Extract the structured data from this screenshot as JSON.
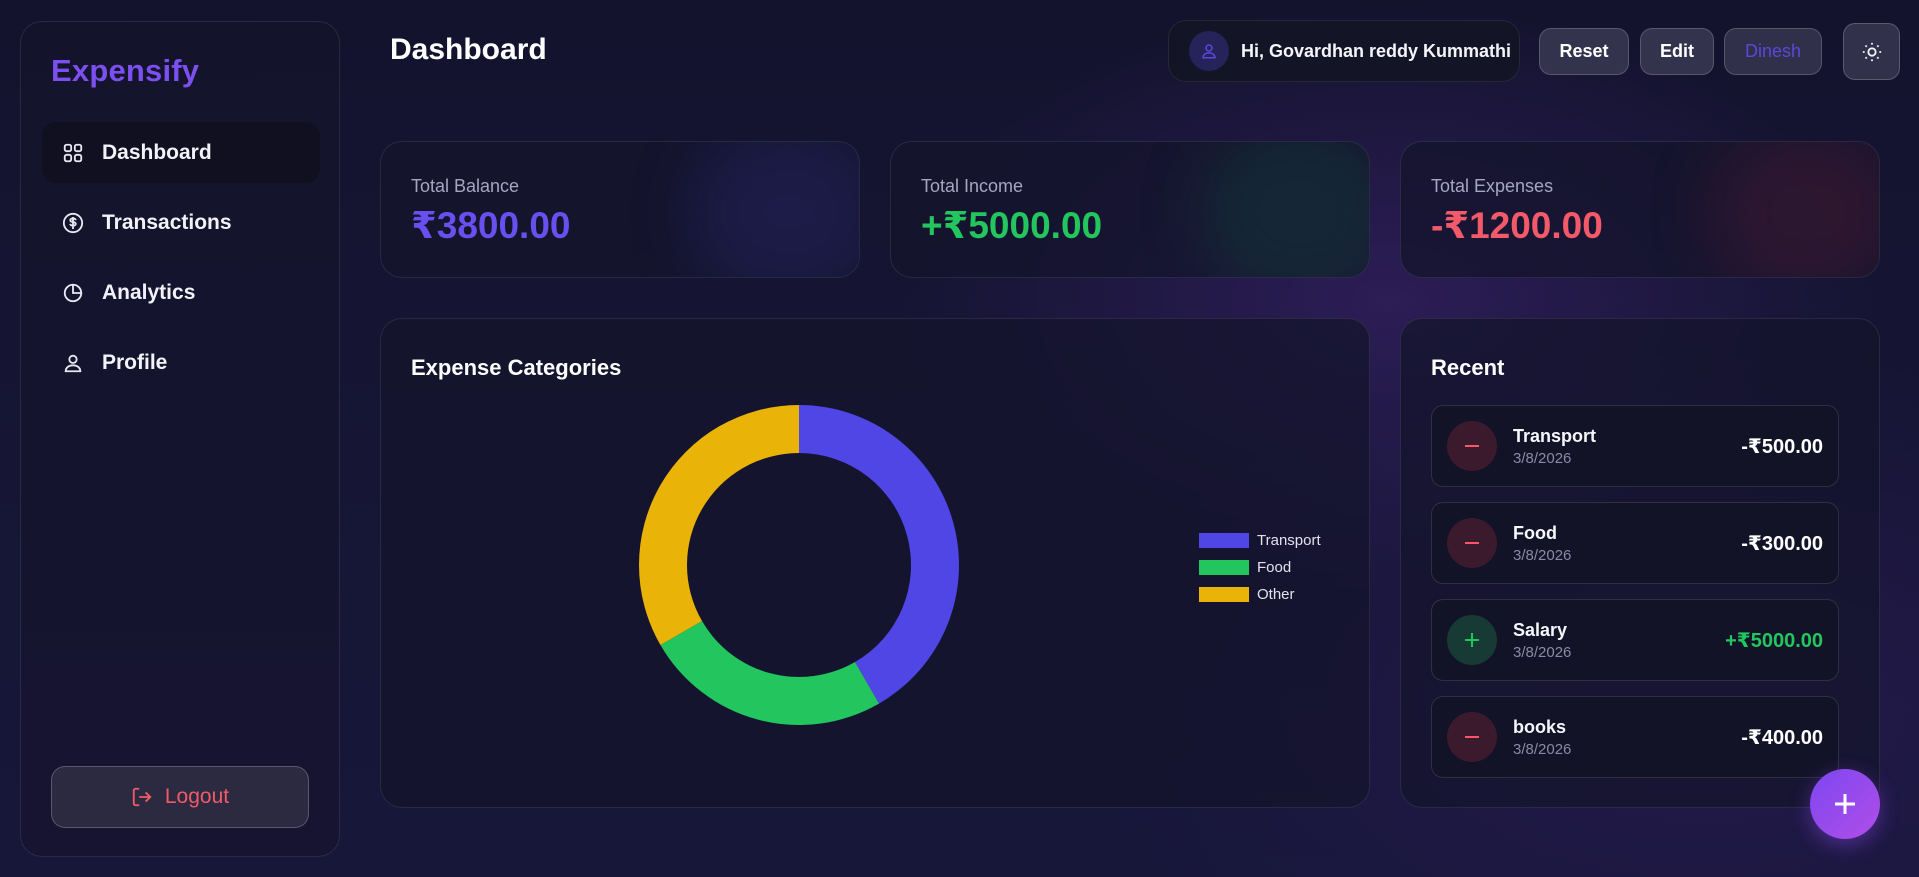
{
  "brand": "Expensify",
  "nav": [
    {
      "label": "Dashboard",
      "icon": "grid-icon",
      "active": true
    },
    {
      "label": "Transactions",
      "icon": "dollar-circle-icon",
      "active": false
    },
    {
      "label": "Analytics",
      "icon": "pie-chart-icon",
      "active": false
    },
    {
      "label": "Profile",
      "icon": "user-icon",
      "active": false
    }
  ],
  "logout_label": "Logout",
  "header": {
    "title": "Dashboard",
    "greeting": "Hi, Govardhan reddy Kummathi",
    "reset_label": "Reset",
    "edit_label": "Edit",
    "user_label": "Dinesh"
  },
  "stats": {
    "balance": {
      "label": "Total Balance",
      "value": "₹3800.00"
    },
    "income": {
      "label": "Total Income",
      "value": "+₹5000.00"
    },
    "expenses": {
      "label": "Total Expenses",
      "value": "-₹1200.00"
    }
  },
  "chart_title": "Expense Categories",
  "chart_data": {
    "type": "pie",
    "categories": [
      "Transport",
      "Food",
      "Other"
    ],
    "values": [
      500,
      300,
      400
    ],
    "colors": [
      "#4f46e5",
      "#22c55e",
      "#eab308"
    ],
    "legend": "right"
  },
  "recent": {
    "title": "Recent",
    "items": [
      {
        "name": "Transport",
        "date": "3/8/2026",
        "amount": "-₹500.00",
        "type": "expense"
      },
      {
        "name": "Food",
        "date": "3/8/2026",
        "amount": "-₹300.00",
        "type": "expense"
      },
      {
        "name": "Salary",
        "date": "3/8/2026",
        "amount": "+₹5000.00",
        "type": "income"
      },
      {
        "name": "books",
        "date": "3/8/2026",
        "amount": "-₹400.00",
        "type": "expense"
      }
    ]
  },
  "colors": {
    "accent": "#7c4ff0",
    "income": "#22c55e",
    "expense": "#f25a6a"
  }
}
